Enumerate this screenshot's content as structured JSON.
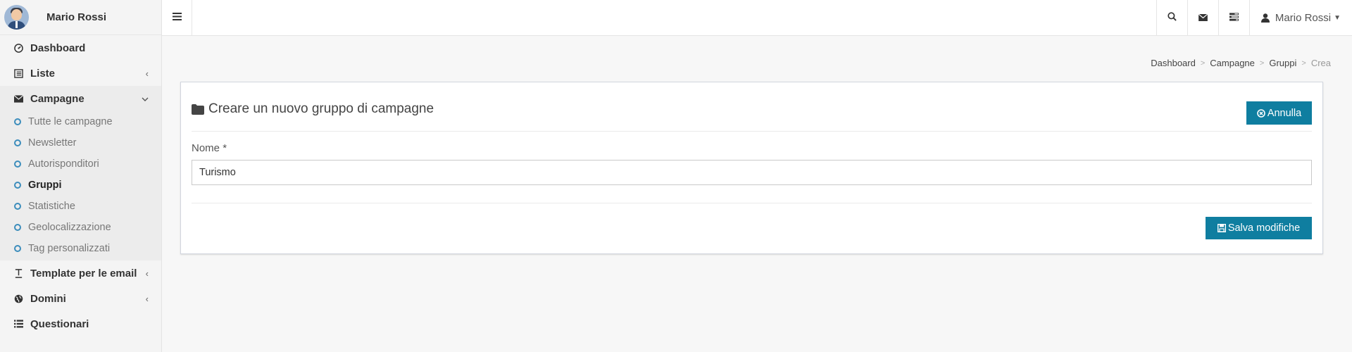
{
  "user": {
    "name": "Mario Rossi"
  },
  "sidebar": {
    "items": [
      {
        "label": "Dashboard",
        "icon": "dashboard-icon",
        "arrow": ""
      },
      {
        "label": "Liste",
        "icon": "list-alt-icon",
        "arrow": "‹"
      },
      {
        "label": "Campagne",
        "icon": "envelope-icon",
        "arrow": "⌄"
      }
    ],
    "submenu": [
      {
        "label": "Tutte le campagne",
        "active": false
      },
      {
        "label": "Newsletter",
        "active": false
      },
      {
        "label": "Autorisponditori",
        "active": false
      },
      {
        "label": "Gruppi",
        "active": true
      },
      {
        "label": "Statistiche",
        "active": false
      },
      {
        "label": "Geolocalizzazione",
        "active": false
      },
      {
        "label": "Tag personalizzati",
        "active": false
      }
    ],
    "items_after": [
      {
        "label": "Template per le email",
        "icon": "text-icon",
        "arrow": "‹"
      },
      {
        "label": "Domini",
        "icon": "globe-icon",
        "arrow": "‹"
      },
      {
        "label": "Questionari",
        "icon": "list-icon",
        "arrow": ""
      }
    ]
  },
  "navbar": {
    "toggle_icon": "hamburger-icon",
    "user_label": "Mario Rossi"
  },
  "breadcrumb": {
    "items": [
      "Dashboard",
      "Campagne",
      "Gruppi"
    ],
    "current": "Crea"
  },
  "box": {
    "title": "Creare un nuovo gruppo di campagne",
    "cancel_label": "Annulla",
    "field_label": "Nome",
    "field_required": "*",
    "field_value": "Turismo",
    "save_label": "Salva modifiche"
  },
  "colors": {
    "accent": "#0f7ea0",
    "submenu_circle": "#3c8dbc"
  }
}
